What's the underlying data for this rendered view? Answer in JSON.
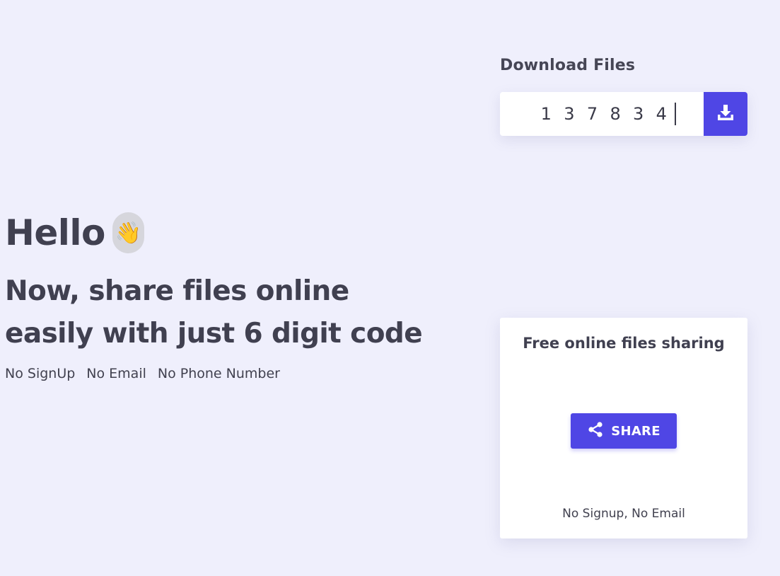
{
  "download": {
    "title": "Download Files",
    "code_digits": [
      "1",
      "3",
      "7",
      "8",
      "3",
      "4"
    ],
    "button_icon": "download-icon"
  },
  "hero": {
    "greeting": "Hello",
    "greeting_emoji": "👋",
    "headline_line1": "Now, share files online",
    "headline_line2": "easily with just 6 digit code",
    "features": [
      "No SignUp",
      "No Email",
      "No Phone Number"
    ]
  },
  "share_card": {
    "title": "Free online files sharing",
    "button_label": "SHARE",
    "button_icon": "share-icon",
    "footer": "No Signup, No Email"
  },
  "colors": {
    "background": "#efeffc",
    "accent": "#4f46e5",
    "text": "#41414f",
    "card": "#ffffff"
  }
}
